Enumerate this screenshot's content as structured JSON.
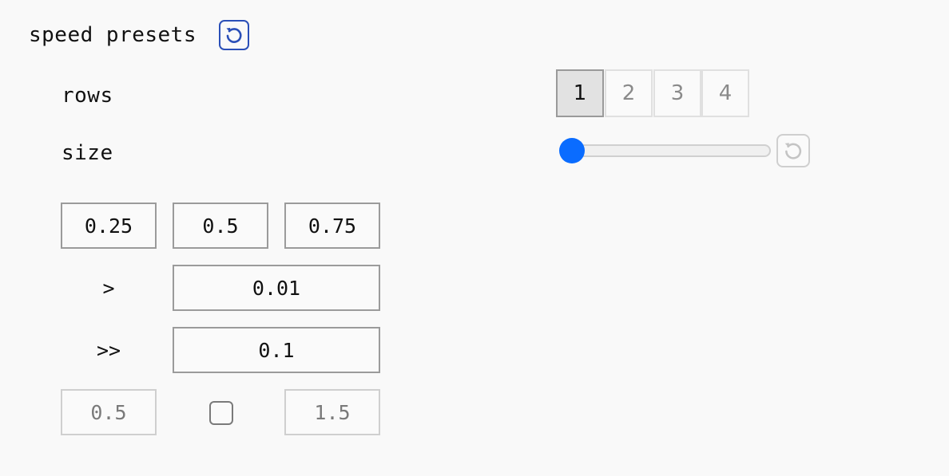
{
  "header": {
    "title": "speed presets",
    "reset_icon": "reset-icon",
    "accent_color": "#2a4fb8"
  },
  "rows": {
    "label": "rows",
    "options": [
      "1",
      "2",
      "3",
      "4"
    ],
    "selected": "1"
  },
  "size": {
    "label": "size",
    "slider_value_fraction": 0,
    "slider_color": "#0a6cff",
    "reset_icon": "reset-icon"
  },
  "presets": {
    "values": [
      "0.25",
      "0.5",
      "0.75"
    ]
  },
  "steps": {
    "small": {
      "symbol": ">",
      "value": "0.01"
    },
    "large": {
      "symbol": ">>",
      "value": "0.1"
    }
  },
  "range": {
    "min": "0.5",
    "max": "1.5",
    "checked": false
  }
}
